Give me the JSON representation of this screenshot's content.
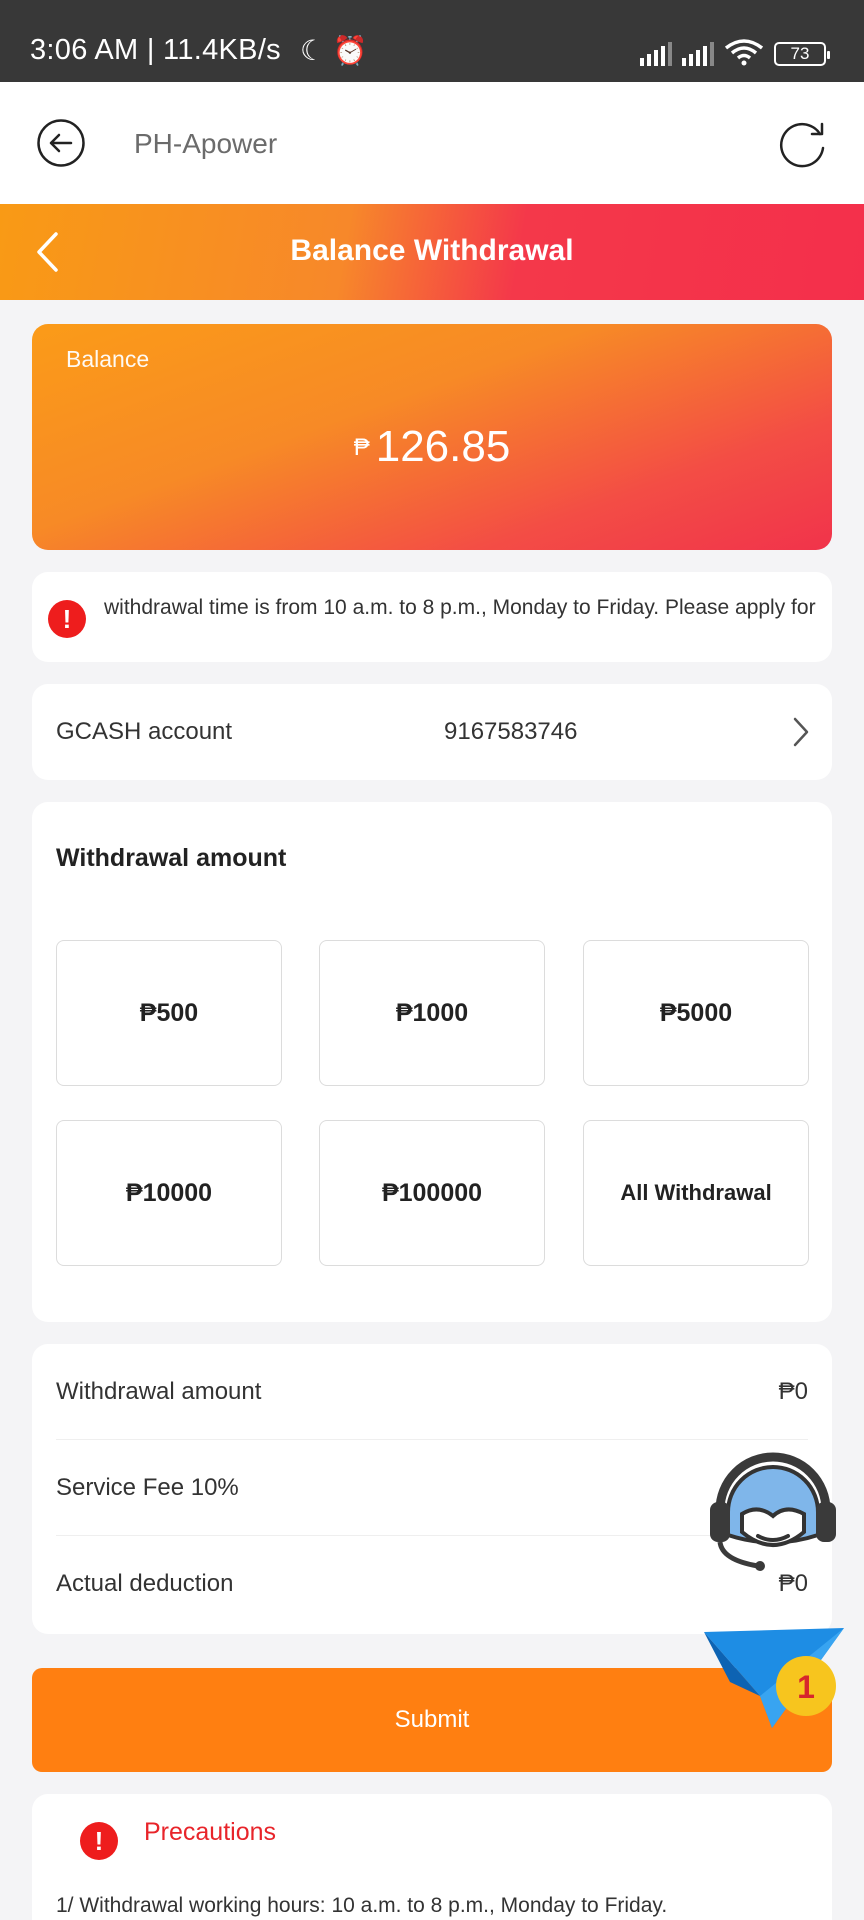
{
  "status_bar": {
    "time": "3:06 AM | 11.4KB/s",
    "status_icons": "☾ ⏰",
    "battery": "73"
  },
  "app_bar": {
    "title": "PH-Apower"
  },
  "header": {
    "title": "Balance Withdrawal"
  },
  "balance": {
    "label": "Balance",
    "currency": "₱",
    "amount": "126.85"
  },
  "notice": {
    "icon_text": "!",
    "text": "withdrawal time is from 10 a.m. to 8 p.m., Monday to Friday. Please apply for"
  },
  "account": {
    "label": "GCASH account",
    "value": "9167583746"
  },
  "withdrawal": {
    "heading": "Withdrawal amount",
    "options": [
      "₱500",
      "₱1000",
      "₱5000",
      "₱10000",
      "₱100000",
      "All Withdrawal"
    ]
  },
  "summary": {
    "rows": [
      {
        "label": "Withdrawal amount",
        "value": "₱0"
      },
      {
        "label": "Service Fee 10%",
        "value": ""
      },
      {
        "label": "Actual deduction",
        "value": "₱0"
      }
    ]
  },
  "submit_label": "Submit",
  "precautions": {
    "icon_text": "!",
    "title": "Precautions",
    "line1": "1/ Withdrawal working hours: 10 a.m. to 8 p.m., Monday to Friday."
  },
  "floating": {
    "badge": "1"
  },
  "colors": {
    "accent_orange": "#ff7f11",
    "accent_red": "#f42f4b",
    "alert_red": "#ee1d1d"
  }
}
